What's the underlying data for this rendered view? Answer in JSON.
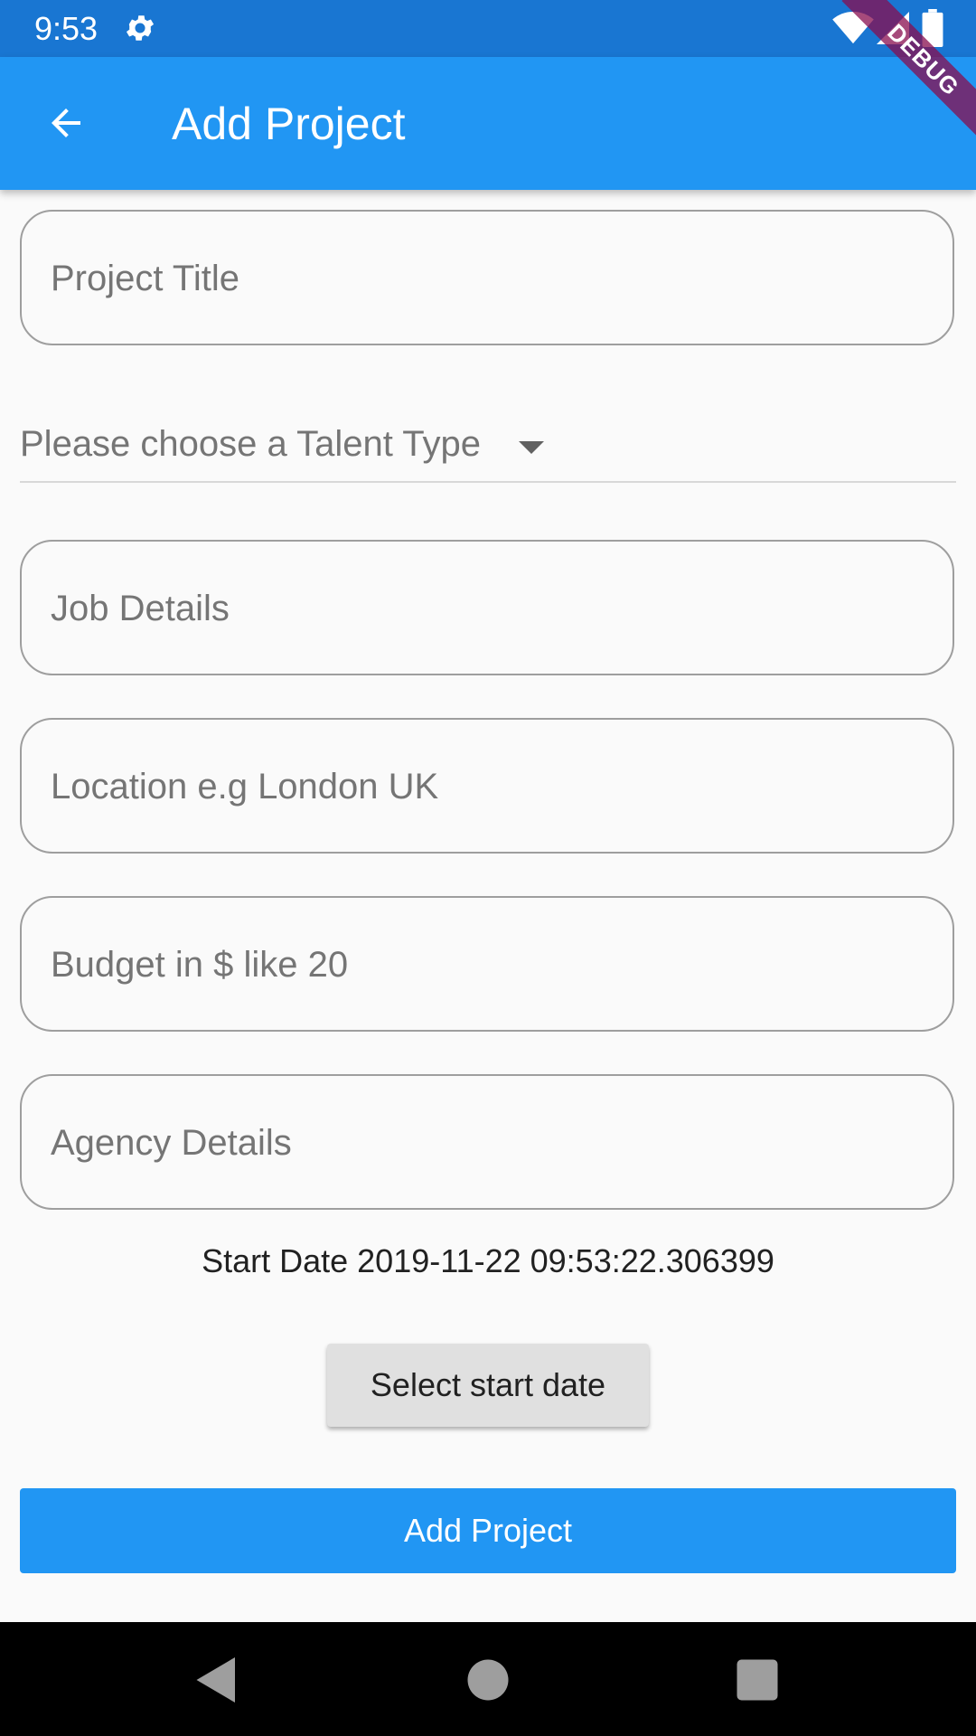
{
  "status_bar": {
    "time": "9:53",
    "icons": [
      "gear-icon",
      "wifi-icon",
      "signal-icon",
      "battery-icon"
    ]
  },
  "app_bar": {
    "title": "Add Project",
    "back_icon": "arrow-left-icon",
    "color": "#2196f3"
  },
  "debug_banner": "DEBUG",
  "form": {
    "project_title_placeholder": "Project Title",
    "talent_type_label": "Please choose a Talent Type",
    "job_details_placeholder": "Job Details",
    "location_placeholder": "Location e.g London UK",
    "budget_placeholder": "Budget in $ like 20",
    "agency_details_placeholder": "Agency Details"
  },
  "start_date_text": "Start Date 2019-11-22 09:53:22.306399",
  "buttons": {
    "select_start_date": "Select start date",
    "add_project": "Add Project"
  },
  "nav_bar": {
    "icons": [
      "back-triangle-icon",
      "home-circle-icon",
      "recents-square-icon"
    ]
  }
}
